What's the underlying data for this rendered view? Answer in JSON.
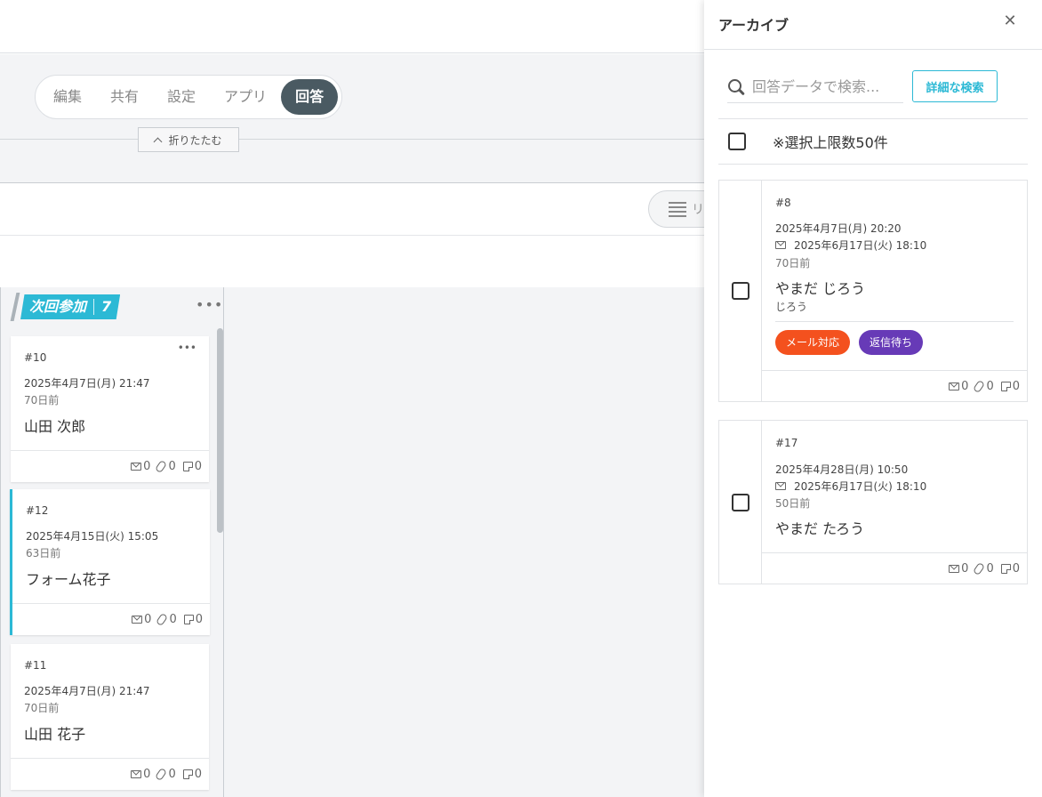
{
  "nav": {
    "tabs": [
      {
        "label": "編集"
      },
      {
        "label": "共有"
      },
      {
        "label": "設定"
      },
      {
        "label": "アプリ"
      },
      {
        "label": "回答",
        "active": true
      }
    ],
    "collapse_label": "折りたたむ"
  },
  "toolbar": {
    "view_label": "リ"
  },
  "board": {
    "column": {
      "title": "次回参加",
      "count": "7",
      "more": "•••",
      "cards": [
        {
          "number": "#10",
          "date": "2025年4月7日(月) 21:47",
          "ago": "70日前",
          "name": "山田 次郎",
          "mail": "0",
          "files": "0",
          "memos": "0",
          "more": "•••"
        },
        {
          "number": "#12",
          "date": "2025年4月15日(火) 15:05",
          "ago": "63日前",
          "name": "フォーム花子",
          "mail": "0",
          "files": "0",
          "memos": "0"
        },
        {
          "number": "#11",
          "date": "2025年4月7日(月) 21:47",
          "ago": "70日前",
          "name": "山田 花子",
          "mail": "0",
          "files": "0",
          "memos": "0"
        }
      ]
    }
  },
  "drawer": {
    "title": "アーカイブ",
    "close": "✕",
    "search": {
      "placeholder": "回答データで検索..."
    },
    "advanced_search_label": "詳細な検索",
    "select_limit_label": "※選択上限数50件",
    "cards": [
      {
        "number": "#8",
        "date": "2025年4月7日(月) 20:20",
        "mail_date": "2025年6月17日(火) 18:10",
        "ago": "70日前",
        "name": "やまだ じろう",
        "kana": "じろう",
        "tags": [
          {
            "label": "メール対応",
            "color": "#f4511e"
          },
          {
            "label": "返信待ち",
            "color": "#673ab7"
          }
        ],
        "mail": "0",
        "files": "0",
        "memos": "0"
      },
      {
        "number": "#17",
        "date": "2025年4月28日(月) 10:50",
        "mail_date": "2025年6月17日(火) 18:10",
        "ago": "50日前",
        "name": "やまだ たろう",
        "mail": "0",
        "files": "0",
        "memos": "0"
      }
    ]
  },
  "colors": {
    "accent": "#2cb9d5",
    "active_tab": "#4a5a62",
    "tag_orange": "#f4511e",
    "tag_purple": "#673ab7"
  },
  "icons": [
    "search-icon",
    "close-icon",
    "mail-icon",
    "paperclip-icon",
    "memo-icon",
    "list-icon",
    "chevron-up-icon",
    "more-icon",
    "checkbox"
  ]
}
